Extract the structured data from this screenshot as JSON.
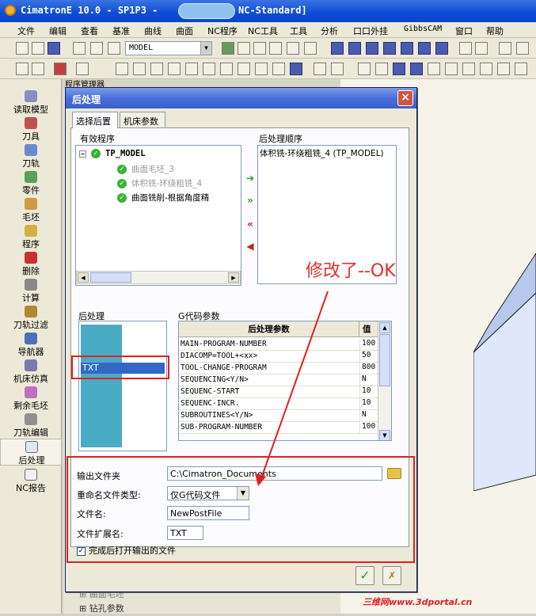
{
  "window": {
    "title_left": "CimatronE 10.0 - SP1P3 -",
    "title_right": "NC-Standard]"
  },
  "menu": [
    "文件",
    "编辑",
    "查看",
    "基准",
    "曲线",
    "曲面",
    "NC程序",
    "NC工具",
    "工具",
    "分析",
    "口口外挂",
    "GibbsCAM",
    "窗口",
    "帮助"
  ],
  "toolbar": {
    "model_combo": "MODEL"
  },
  "sidebar": {
    "items": [
      {
        "label": "读取模型",
        "icon": "read-model-icon"
      },
      {
        "label": "刀具",
        "icon": "tool-icon"
      },
      {
        "label": "刀轨",
        "icon": "toolpath-icon"
      },
      {
        "label": "零件",
        "icon": "part-icon"
      },
      {
        "label": "毛坯",
        "icon": "stock-icon"
      },
      {
        "label": "程序",
        "icon": "program-icon"
      },
      {
        "label": "删除",
        "icon": "delete-icon"
      },
      {
        "label": "计算",
        "icon": "calculate-icon"
      },
      {
        "label": "刀轨过滤",
        "icon": "toolpath-filter-icon"
      },
      {
        "label": "导航器",
        "icon": "navigator-icon"
      },
      {
        "label": "机床仿真",
        "icon": "machine-sim-icon"
      },
      {
        "label": "剩余毛坯",
        "icon": "remaining-stock-icon"
      },
      {
        "label": "刀轨编辑",
        "icon": "toolpath-edit-icon"
      },
      {
        "label": "后处理",
        "icon": "post-process-icon"
      },
      {
        "label": "NC报告",
        "icon": "nc-report-icon"
      }
    ]
  },
  "background_panel": {
    "title": "程序管理器",
    "bottom_items": [
      "曲面毛坯",
      "钻孔参数"
    ]
  },
  "dialog": {
    "title": "后处理",
    "tabs": [
      "选择后置",
      "机床参数"
    ],
    "valid_programs_label": "有效程序",
    "tree": {
      "root": "TP_MODEL",
      "children": [
        "曲面毛坯_3",
        "体积铣-环绕粗铣_4",
        "曲面铣削-根据角度精"
      ]
    },
    "order_label": "后处理顺序",
    "order_items": [
      "体积铣-环绕粗铣_4 (TP_MODEL)"
    ],
    "post_label": "后处理",
    "post_selected": "TXT",
    "gcode_label": "G代码参数",
    "gcode_headers": [
      "后处理参数",
      "值"
    ],
    "gcode_rows": [
      {
        "name": "MAIN-PROGRAM-NUMBER",
        "value": "100"
      },
      {
        "name": "DIACOMP=TOOL+<xx>",
        "value": "50"
      },
      {
        "name": "TOOL-CHANGE-PROGRAM",
        "value": "800"
      },
      {
        "name": "SEQUENCING<Y/N>",
        "value": "N"
      },
      {
        "name": "SEQUENC-START",
        "value": "10"
      },
      {
        "name": "SEQUENC-INCR.",
        "value": "10"
      },
      {
        "name": "SUBROUTINES<Y/N>",
        "value": "N"
      },
      {
        "name": "SUB-PROGRAM-NUMBER",
        "value": "100"
      }
    ],
    "output_folder_label": "输出文件夹",
    "output_folder_value": "C:\\Cimatron_Documents",
    "rename_type_label": "重命名文件类型:",
    "rename_type_value": "仅G代码文件",
    "file_name_label": "文件名:",
    "file_name_value": "NewPostFile",
    "file_ext_label": "文件扩展名:",
    "file_ext_value": "TXT",
    "open_after_label": "完成后打开输出的文件",
    "open_after_checked": true
  },
  "annotation": "修改了--OK",
  "watermark": "三维网www.3dportal.cn"
}
